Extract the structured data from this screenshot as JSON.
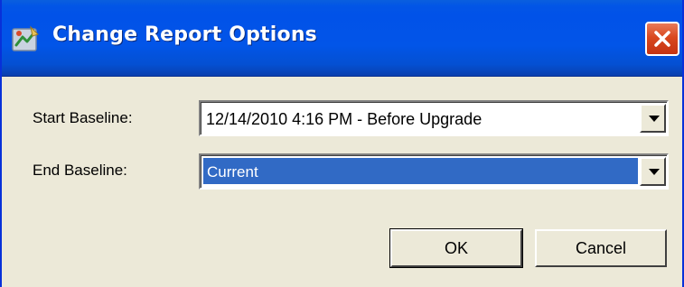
{
  "window": {
    "title": "Change Report Options"
  },
  "form": {
    "start_baseline_label": "Start Baseline:",
    "start_baseline_value": "12/14/2010 4:16 PM - Before Upgrade",
    "end_baseline_label": "End Baseline:",
    "end_baseline_value": "Current"
  },
  "buttons": {
    "ok_label": "OK",
    "cancel_label": "Cancel"
  },
  "colors": {
    "titlebar": "#0255e8",
    "selection": "#316ac5",
    "close_button": "#d9481e",
    "dialog_background": "#ece9d8"
  },
  "icons": {
    "app": "report-options-icon",
    "close": "close-icon",
    "dropdown": "chevron-down-icon"
  }
}
